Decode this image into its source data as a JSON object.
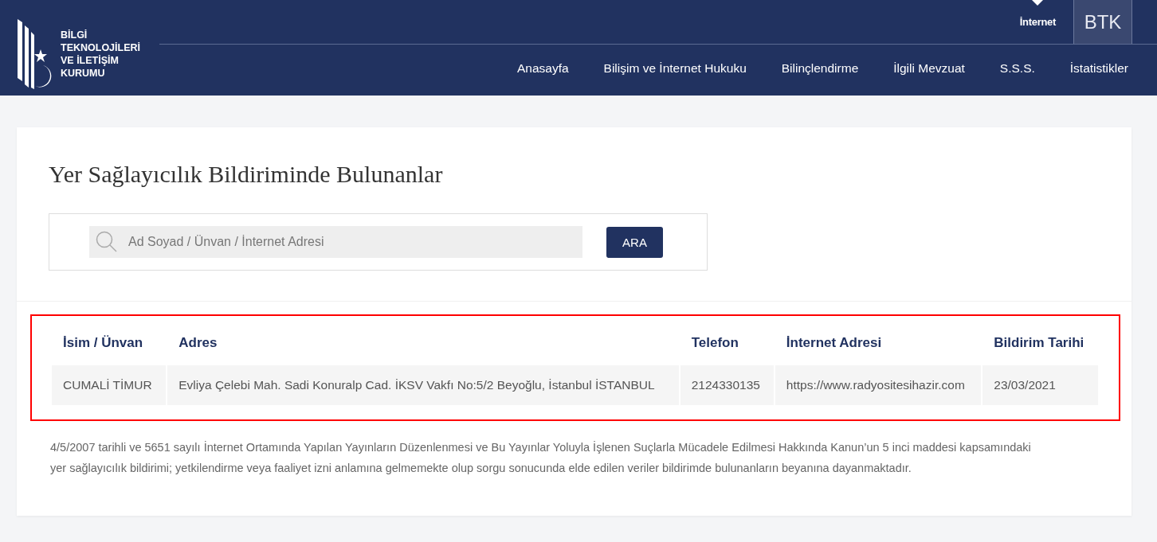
{
  "header": {
    "logo_text": [
      "BİLGİ",
      "TEKNOLOJİLERİ",
      "VE İLETİŞİM",
      "KURUMU"
    ],
    "top_links": [
      {
        "label": "İnternet",
        "selected": true
      }
    ],
    "badge": "BTK",
    "nav": [
      "Anasayfa",
      "Bilişim ve İnternet Hukuku",
      "Bilinçlendirme",
      "İlgili Mevzuat",
      "S.S.S.",
      "İstatistikler"
    ]
  },
  "page": {
    "title": "Yer Sağlayıcılık Bildiriminde Bulunanlar",
    "search": {
      "placeholder": "Ad Soyad / Ünvan / İnternet Adresi",
      "button": "ARA"
    },
    "table": {
      "highlighted": true,
      "columns": [
        "İsim / Ünvan",
        "Adres",
        "Telefon",
        "İnternet Adresi",
        "Bildirim Tarihi"
      ],
      "rows": [
        [
          "CUMALİ TİMUR",
          "Evliya Çelebi Mah. Sadi Konuralp Cad. İKSV Vakfı No:5/2 Beyoğlu, İstanbul İSTANBUL",
          "2124330135",
          "https://www.radyositesihazir.com",
          "23/03/2021"
        ]
      ]
    },
    "note": "4/5/2007 tarihli ve 5651 sayılı İnternet Ortamında Yapılan Yayınların Düzenlenmesi ve Bu Yayınlar Yoluyla İşlenen Suçlarla Mücadele Edilmesi Hakkında Kanun’un 5 inci maddesi kapsamındaki yer sağlayıcılık bildirimi; yetkilendirme veya faaliyet izni anlamına gelmemekte olup sorgu sonucunda elde edilen veriler bildirimde bulunanların beyanına dayanmaktadır."
  }
}
